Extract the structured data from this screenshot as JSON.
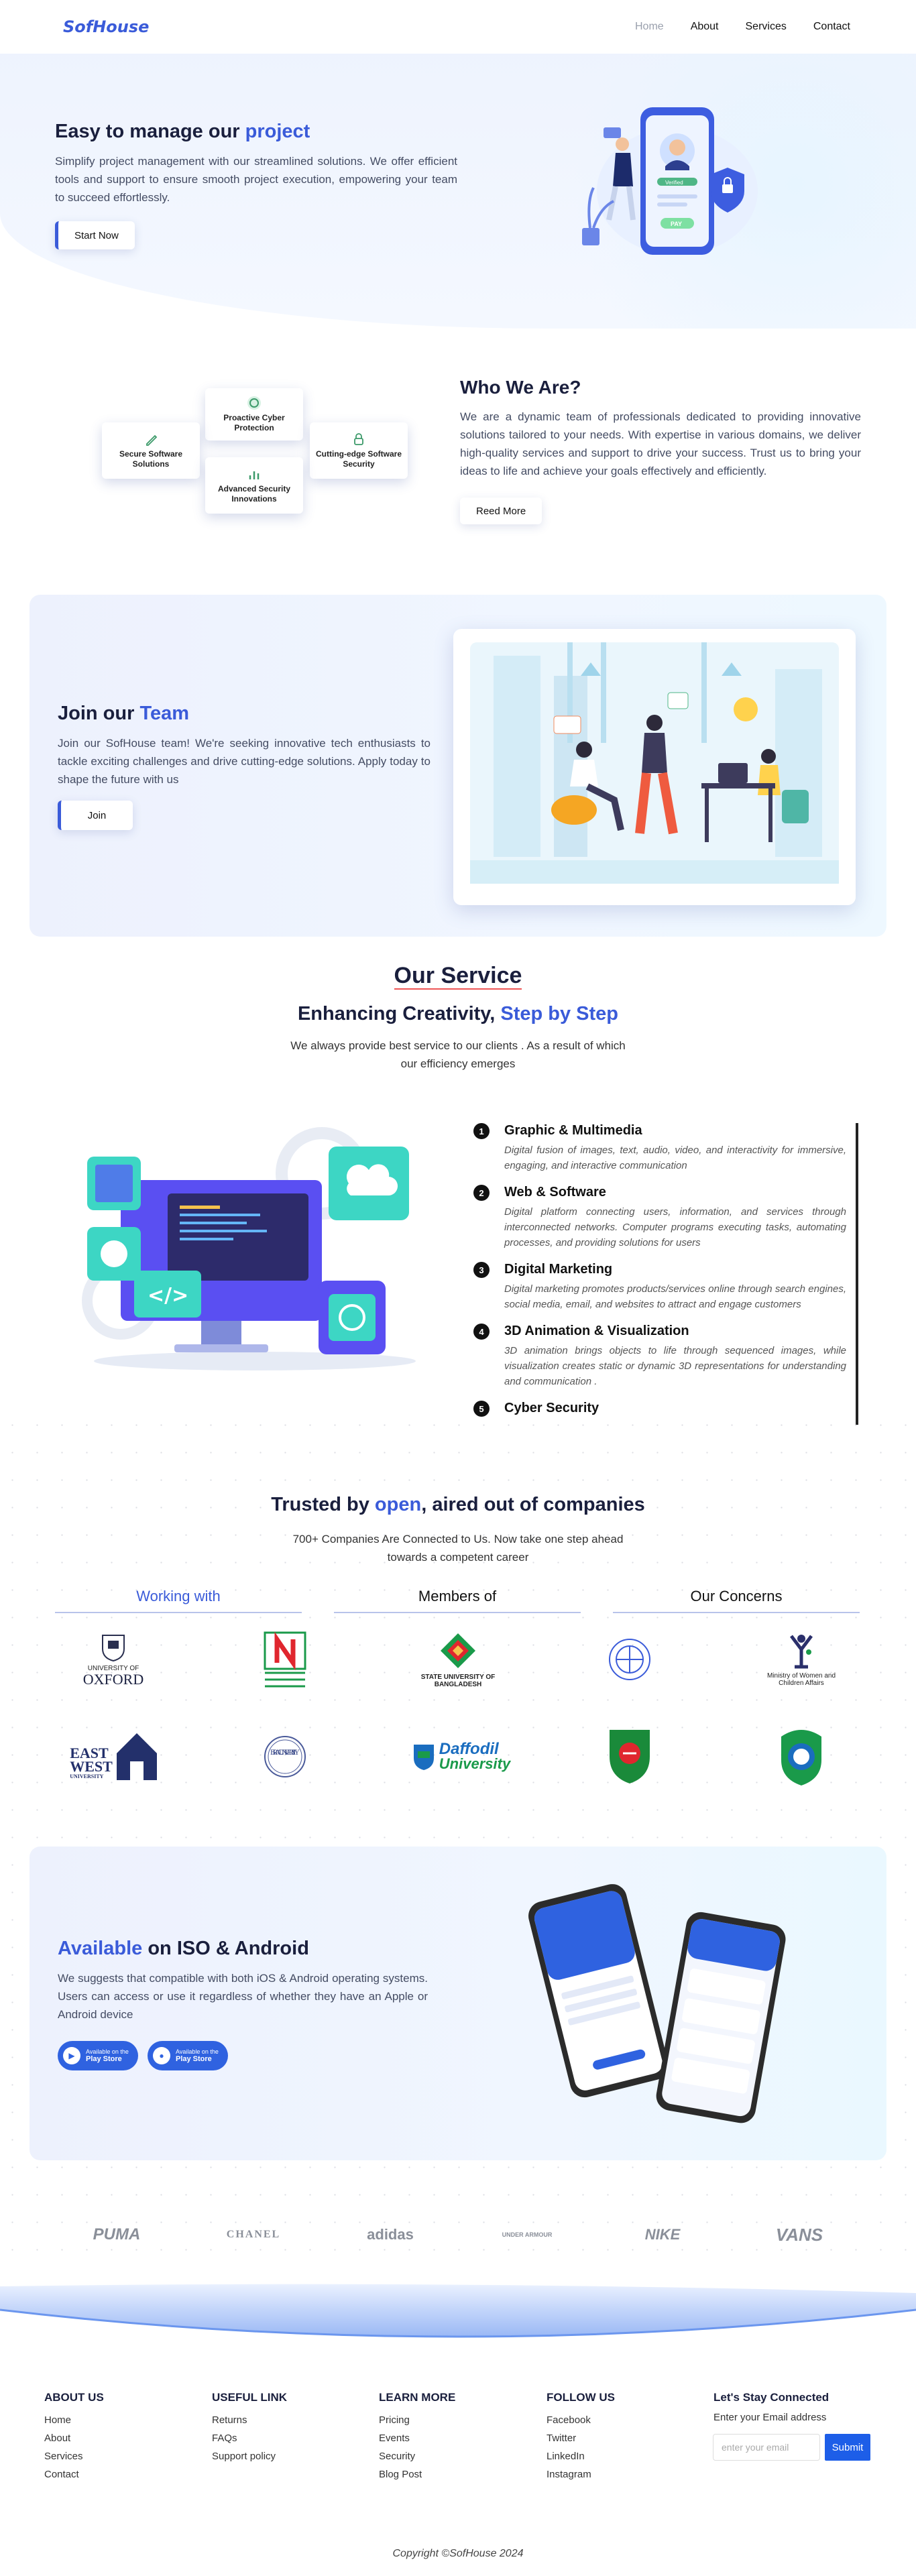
{
  "nav": {
    "logo": "SofHouse",
    "items": [
      "Home",
      "About",
      "Services",
      "Contact"
    ]
  },
  "hero": {
    "title_a": "Easy to manage our ",
    "title_b": "project",
    "text": "Simplify project management with our streamlined solutions. We offer efficient tools and support to ensure smooth project execution, empowering your team to succeed effortlessly.",
    "button": "Start Now",
    "phone_badge": "Verified",
    "phone_btn": "PAY"
  },
  "who": {
    "features": [
      "Proactive Cyber Protection",
      "Secure Software Solutions",
      "Cutting-edge Software Security",
      "Advanced Security Innovations"
    ],
    "title": "Who We Are?",
    "text": "We are a dynamic team of professionals dedicated to providing innovative solutions tailored to your needs. With expertise in various domains, we deliver high-quality services and support to drive your success. Trust us to bring your ideas to life and achieve your goals effectively and efficiently.",
    "button": "Reed More"
  },
  "join": {
    "title_a": "Join our ",
    "title_b": "Team",
    "text": "Join our SofHouse team! We're seeking innovative tech enthusiasts to tackle exciting challenges and drive cutting-edge solutions. Apply today to shape the future with us",
    "button": "Join"
  },
  "service": {
    "title": "Our Service",
    "sub_a": "Enhancing Creativity, ",
    "sub_b": "Step by Step",
    "desc": "We always provide best service to our clients . As a result of which our efficiency emerges",
    "items": [
      {
        "n": "1",
        "title": "Graphic & Multimedia",
        "text": "Digital fusion of images, text, audio, video, and interactivity for immersive, engaging, and interactive communication"
      },
      {
        "n": "2",
        "title": "Web & Software",
        "text": "Digital platform connecting users, information, and services through interconnected networks. Computer programs executing tasks, automating processes, and providing solutions for users"
      },
      {
        "n": "3",
        "title": "Digital Marketing",
        "text": "Digital marketing promotes products/services online through search engines, social media, email, and websites to attract and engage customers"
      },
      {
        "n": "4",
        "title": "3D Animation & Visualization",
        "text": "3D animation brings objects to life through sequenced images, while visualization creates static or dynamic 3D representations for understanding and communication ."
      },
      {
        "n": "5",
        "title": "Cyber Security",
        "text": ""
      }
    ]
  },
  "trusted": {
    "title_a": "Trusted by ",
    "title_b": "open",
    "title_c": ", aired out of companies",
    "desc": "700+ Companies Are Connected to Us. Now take one step ahead towards a competent career",
    "tabs": [
      "Working with",
      "Members of",
      "Our Concerns"
    ],
    "logos": {
      "oxford_a": "UNIVERSITY OF",
      "oxford_b": "OXFORD",
      "sub": "STATE UNIVERSITY OF BANGLADESH",
      "ministry": "Ministry of Women and Children Affairs",
      "ewu_a": "EAST",
      "ewu_b": "WEST",
      "ewu_c": "UNIVERSITY",
      "brac": "BRAC UNIVERSITY",
      "daffodil_a": "Daffodil",
      "daffodil_b": "University"
    }
  },
  "app": {
    "title_a": "Available",
    "title_b": " on ISO & Android",
    "text": "We suggests that compatible with both iOS & Android operating systems. Users can access or use it regardless of whether they have an Apple or Android device",
    "stores": [
      {
        "small": "Available on the",
        "big": "Play Store"
      },
      {
        "small": "Available on the",
        "big": "Play Store"
      }
    ]
  },
  "brands": [
    "PUMA",
    "CHANEL",
    "adidas",
    "UNDER ARMOUR",
    "NIKE",
    "VANS"
  ],
  "footer": {
    "cols": [
      {
        "title": "ABOUT US",
        "links": [
          "Home",
          "About",
          "Services",
          "Contact"
        ]
      },
      {
        "title": "USEFUL LINK",
        "links": [
          "Returns",
          "FAQs",
          "Support policy"
        ]
      },
      {
        "title": "LEARN MORE",
        "links": [
          "Pricing",
          "Events",
          "Security",
          "Blog Post"
        ]
      },
      {
        "title": "FOLLOW US",
        "links": [
          "Facebook",
          "Twitter",
          "LinkedIn",
          "Instagram"
        ]
      }
    ],
    "connect_title": "Let's Stay Connected",
    "connect_text": "Enter your Email address",
    "email_placeholder": "enter your email",
    "submit": "Submit",
    "copyright": "Copyright ©SofHouse 2024"
  }
}
